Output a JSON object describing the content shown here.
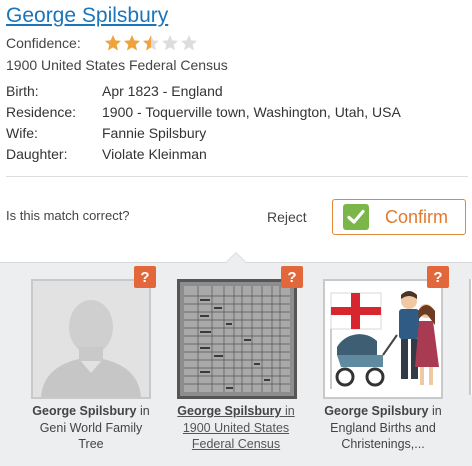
{
  "match": {
    "name": "George Spilsbury",
    "confidence_label": "Confidence:",
    "confidence_stars": 2.5,
    "confidence_max": 5,
    "source": "1900 United States Federal Census",
    "facts": [
      {
        "label": "Birth:",
        "value": "Apr 1823 - England"
      },
      {
        "label": "Residence:",
        "value": "1900 - Toquerville town, Washington, Utah, USA"
      },
      {
        "label": "Wife:",
        "value": "Fannie Spilsbury"
      },
      {
        "label": "Daughter:",
        "value": "Violate Kleinman"
      }
    ],
    "question": "Is this match correct?",
    "reject_label": "Reject",
    "confirm_label": "Confirm"
  },
  "records": [
    {
      "name": "George Spilsbury",
      "in_word": "in",
      "source": "Geni World Family Tree",
      "line1": "George Spilsbury in",
      "line2": "Geni World Family",
      "line3": "Tree",
      "badge": "?"
    },
    {
      "name": "George Spilsbury",
      "in_word": "in",
      "source": "1900 United States Federal Census",
      "line1": "George Spilsbury in",
      "line2": "1900 United States",
      "line3": "Federal Census",
      "badge": "?"
    },
    {
      "name": "George Spilsbury",
      "in_word": "in",
      "source": "England Births and Christenings,...",
      "line1": "George Spilsbury in",
      "line2": "England Births and",
      "line3": "Christenings,...",
      "badge": "?"
    }
  ],
  "colors": {
    "link": "#1b75bb",
    "star_filled": "#f0a33a",
    "star_empty": "#dddddd",
    "confirm_border": "#e0883b",
    "check_green": "#7ab648",
    "badge": "#e2673a"
  }
}
